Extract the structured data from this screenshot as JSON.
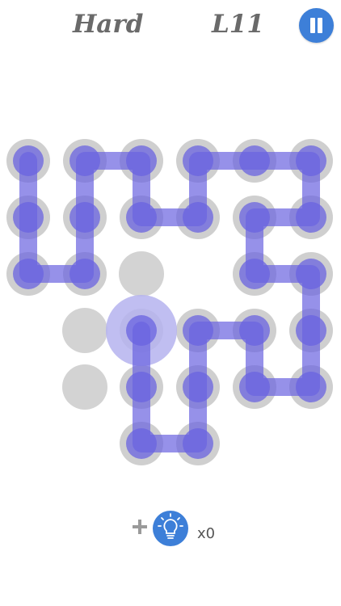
{
  "header": {
    "difficulty": "Hard",
    "level": "L11",
    "pause_icon": "pause-icon"
  },
  "board": {
    "rows": 6,
    "cols": 6,
    "colors": {
      "empty_dot": "#d3d3d3",
      "filled_ring": "#cfcfcf",
      "path": "#6a63e0",
      "path_fill_opacity": 0.75,
      "head_halo": "#b5b3ef"
    },
    "filled_cells": [
      [
        0,
        0
      ],
      [
        0,
        1
      ],
      [
        0,
        2
      ],
      [
        0,
        3
      ],
      [
        0,
        4
      ],
      [
        0,
        5
      ],
      [
        1,
        0
      ],
      [
        1,
        1
      ],
      [
        1,
        2
      ],
      [
        1,
        3
      ],
      [
        1,
        4
      ],
      [
        1,
        5
      ],
      [
        2,
        0
      ],
      [
        2,
        1
      ],
      [
        2,
        4
      ],
      [
        2,
        5
      ],
      [
        3,
        2
      ],
      [
        3,
        3
      ],
      [
        3,
        4
      ],
      [
        3,
        5
      ],
      [
        4,
        2
      ],
      [
        4,
        3
      ],
      [
        4,
        4
      ],
      [
        4,
        5
      ],
      [
        5,
        2
      ],
      [
        5,
        3
      ]
    ],
    "empty_cells": [
      [
        2,
        2
      ],
      [
        3,
        1
      ],
      [
        4,
        1
      ]
    ],
    "path": [
      [
        0,
        0
      ],
      [
        1,
        0
      ],
      [
        2,
        0
      ],
      [
        2,
        1
      ],
      [
        1,
        1
      ],
      [
        0,
        1
      ],
      [
        0,
        2
      ],
      [
        1,
        2
      ],
      [
        1,
        3
      ],
      [
        0,
        3
      ],
      [
        0,
        4
      ],
      [
        0,
        5
      ],
      [
        1,
        5
      ],
      [
        1,
        4
      ],
      [
        2,
        4
      ],
      [
        2,
        5
      ],
      [
        3,
        5
      ],
      [
        4,
        5
      ],
      [
        4,
        4
      ],
      [
        3,
        4
      ],
      [
        3,
        3
      ],
      [
        4,
        3
      ],
      [
        5,
        3
      ],
      [
        5,
        2
      ],
      [
        4,
        2
      ],
      [
        3,
        2
      ]
    ],
    "head": [
      3,
      2
    ]
  },
  "footer": {
    "plus_icon": "plus-icon",
    "hint_icon": "lightbulb-icon",
    "hint_count": "x0"
  }
}
